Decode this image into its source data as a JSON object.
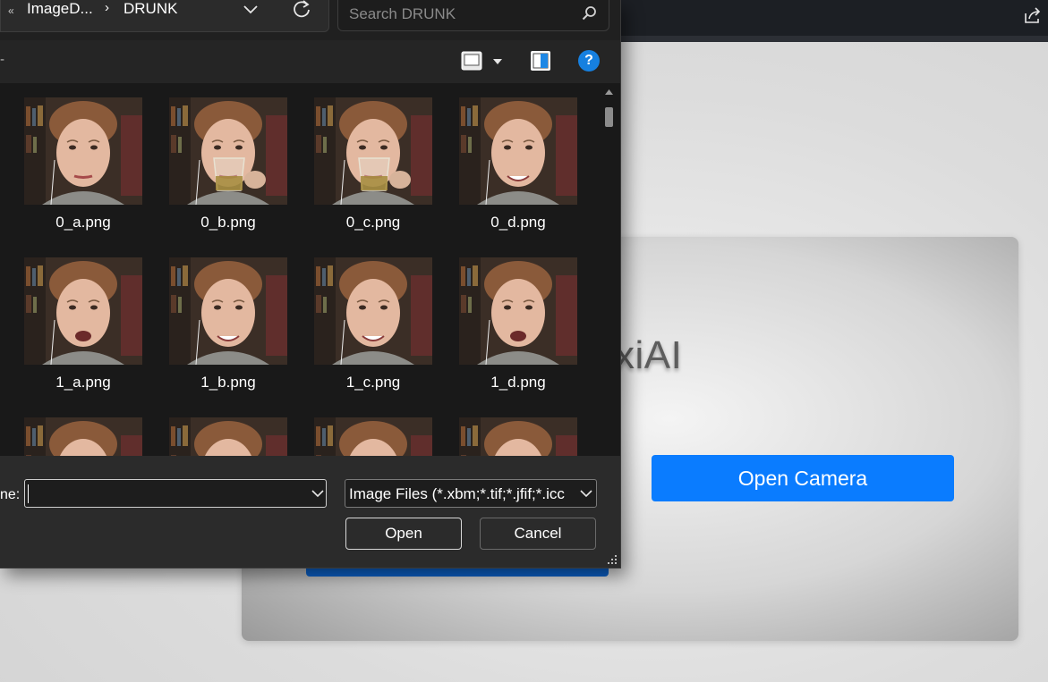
{
  "browser": {
    "share_icon": "share-icon"
  },
  "app": {
    "title": "oxiAI",
    "open_camera_label": "Open Camera"
  },
  "dialog": {
    "breadcrumb": {
      "parent": "ImageD...",
      "current": "DRUNK"
    },
    "search_placeholder": "Search DRUNK",
    "files": [
      {
        "name": "0_a.png",
        "variant": "neutral"
      },
      {
        "name": "0_b.png",
        "variant": "drink"
      },
      {
        "name": "0_c.png",
        "variant": "drink"
      },
      {
        "name": "0_d.png",
        "variant": "smile"
      },
      {
        "name": "1_a.png",
        "variant": "talk"
      },
      {
        "name": "1_b.png",
        "variant": "smile"
      },
      {
        "name": "1_c.png",
        "variant": "smile"
      },
      {
        "name": "1_d.png",
        "variant": "talk"
      },
      {
        "name": "",
        "variant": "partial"
      },
      {
        "name": "",
        "variant": "partial"
      },
      {
        "name": "",
        "variant": "partial"
      },
      {
        "name": "",
        "variant": "partial"
      }
    ],
    "file_name_label": "ne:",
    "file_name_value": "",
    "file_type_filter": "Image Files (*.xbm;*.tif;*.jfif;*.icc",
    "open_label": "Open",
    "cancel_label": "Cancel",
    "accent_color": "#1680e0"
  }
}
